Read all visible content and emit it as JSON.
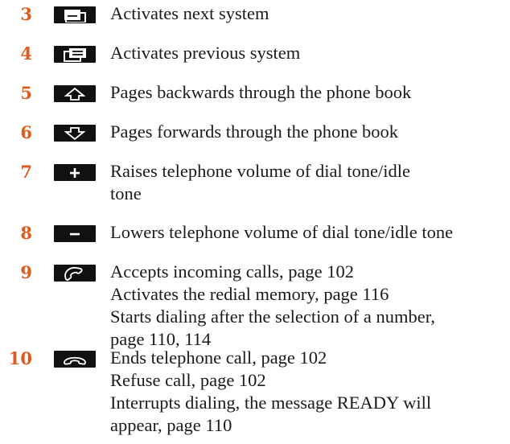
{
  "colors": {
    "number": "#e05a1e",
    "key_background": "#111111",
    "key_symbol": "#ffffff",
    "text": "#1a1a1a"
  },
  "items": [
    {
      "number": "3",
      "icon": "next-system-icon",
      "lines": [
        "Activates next system"
      ]
    },
    {
      "number": "4",
      "icon": "previous-system-icon",
      "lines": [
        "Activates previous system"
      ]
    },
    {
      "number": "5",
      "icon": "page-up-arrow-icon",
      "lines": [
        "Pages backwards through the phone book"
      ]
    },
    {
      "number": "6",
      "icon": "page-down-arrow-icon",
      "lines": [
        "Pages forwards through the phone book"
      ]
    },
    {
      "number": "7",
      "icon": "plus-icon",
      "lines": [
        "Raises telephone volume of dial tone/idle",
        "tone"
      ]
    },
    {
      "number": "8",
      "icon": "minus-icon",
      "lines": [
        "Lowers telephone volume of dial tone/idle tone"
      ]
    },
    {
      "number": "9",
      "icon": "handset-offhook-icon",
      "lines": [
        "Accepts incoming calls, page 102",
        "Activates the redial memory, page 116",
        "Starts dialing after the selection of a number,",
        "page 110, 114"
      ]
    },
    {
      "number": "10",
      "icon": "handset-onhook-icon",
      "lines": [
        "Ends telephone call, page 102",
        "Refuse call, page 102",
        "Interrupts dialing, the message READY will",
        "appear, page 110"
      ]
    }
  ]
}
